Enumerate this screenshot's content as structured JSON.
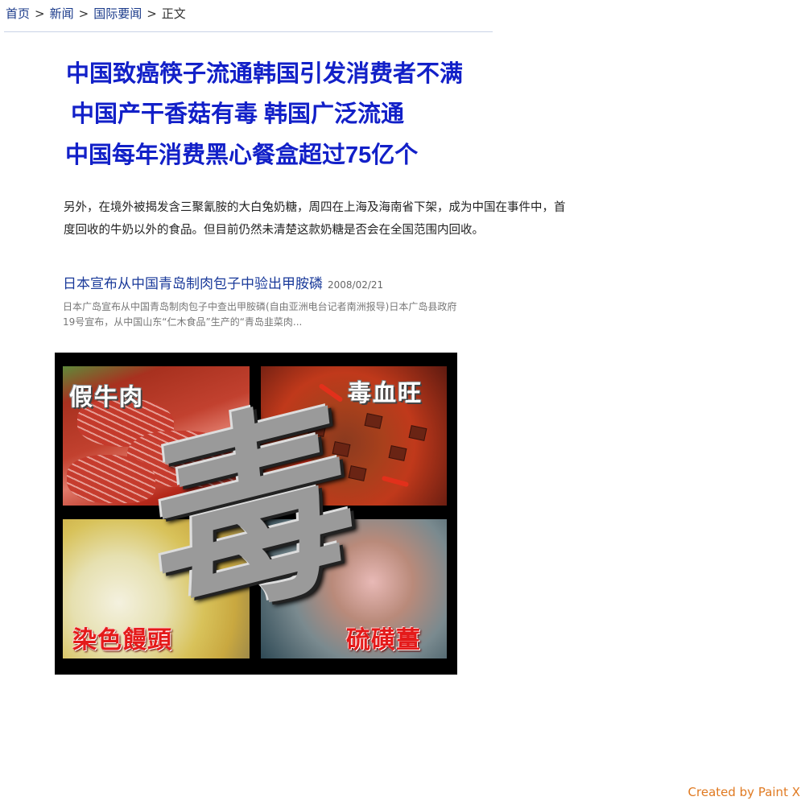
{
  "breadcrumb": {
    "items": [
      "首页",
      "新闻",
      "国际要闻"
    ],
    "separator": ">",
    "current": "正文"
  },
  "headlines": [
    "中国致癌筷子流通韩国引发消费者不满",
    "中国产干香菇有毒 韩国广泛流通",
    "中国每年消费黑心餐盒超过75亿个"
  ],
  "article": {
    "paragraph": "另外，在境外被揭发含三聚氰胺的大白兔奶糖，周四在上海及海南省下架，成为中国在事件中，首度回收的牛奶以外的食品。但目前仍然未清楚这款奶糖是否会在全国范围内回收。"
  },
  "related": {
    "title": "日本宣布从中国青岛制肉包子中验出甲胺磷",
    "date": "2008/02/21",
    "summary": "日本广岛宣布从中国青岛制肉包子中查出甲胺磷(自由亚洲电台记者南洲报导)日本广岛县政府19号宣布，从中国山东“仁木食品”生产的“青岛韭菜肉..."
  },
  "collage": {
    "center_glyph": "毒",
    "labels": {
      "beef": "假牛肉",
      "blood": "毒血旺",
      "bun": "染色饅頭",
      "ginger": "硫磺薑"
    },
    "colors": {
      "white_label": "#ffffff",
      "red_label": "#e41a1a"
    }
  },
  "credit": "Created by Paint X",
  "colors": {
    "headline": "#1220c8",
    "link": "#1a3a8a",
    "credit": "#e07a22"
  }
}
